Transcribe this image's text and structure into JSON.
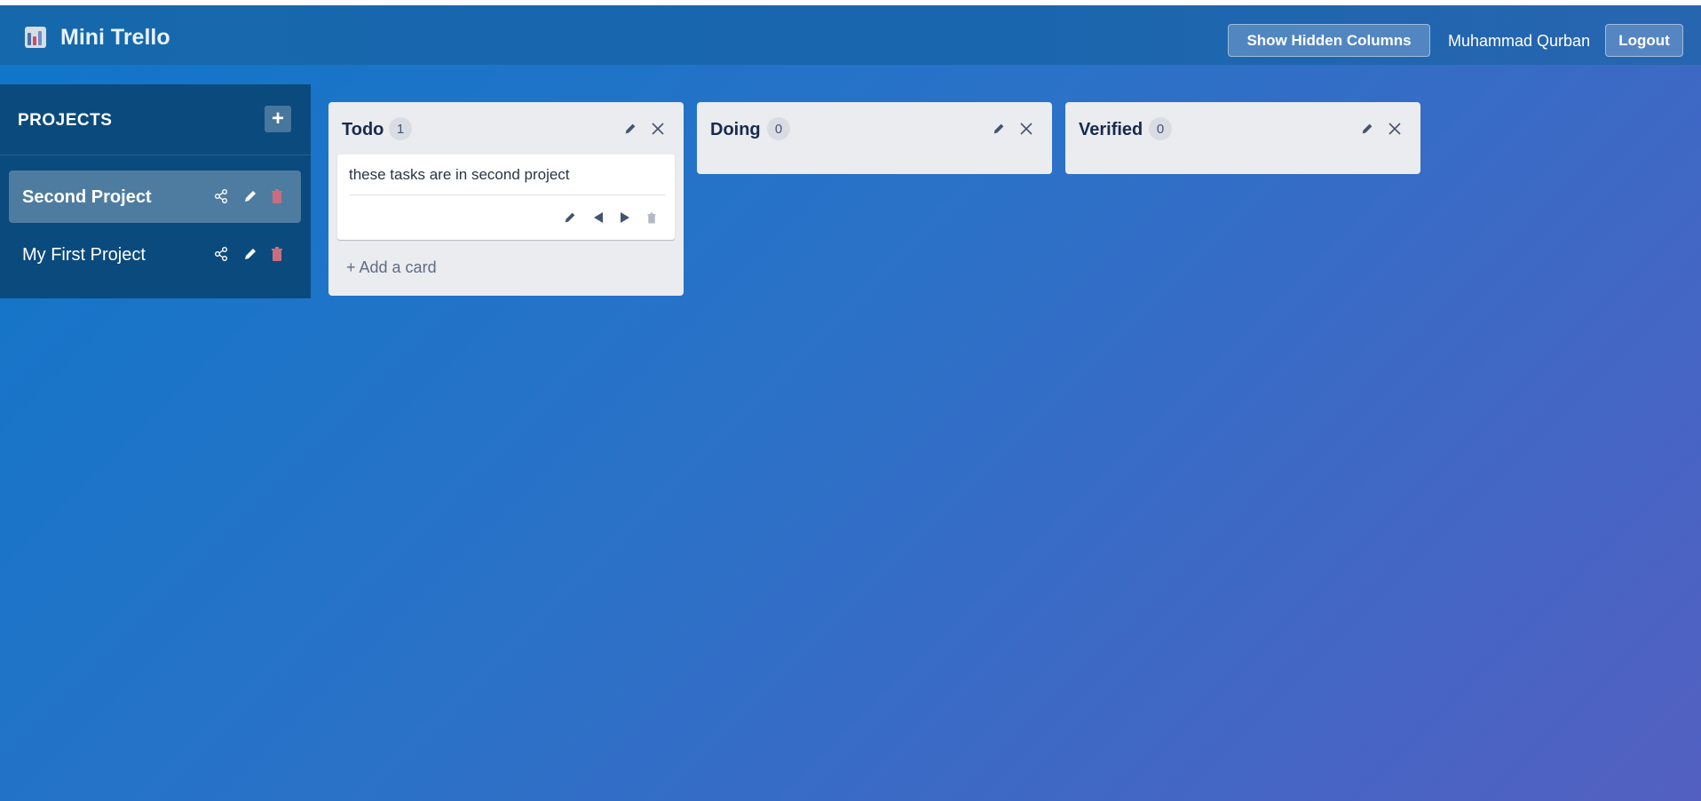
{
  "header": {
    "app_title": "Mini Trello",
    "logo_icon": "chart-icon",
    "show_hidden_label": "Show Hidden Columns",
    "user_name": "Muhammad Qurban",
    "logout_label": "Logout"
  },
  "sidebar": {
    "title": "PROJECTS",
    "add_label": "+",
    "projects": [
      {
        "name": "Second Project",
        "active": true,
        "icons": [
          "share-icon",
          "pencil-icon",
          "trash-icon"
        ]
      },
      {
        "name": "My First Project",
        "active": false,
        "icons": [
          "share-icon",
          "pencil-icon",
          "trash-icon"
        ]
      }
    ]
  },
  "board": {
    "columns": [
      {
        "title": "Todo",
        "count": "1",
        "cards": [
          {
            "text": "these tasks are in second project"
          }
        ],
        "add_card_label": "+ Add a card"
      },
      {
        "title": "Doing",
        "count": "0",
        "cards": []
      },
      {
        "title": "Verified",
        "count": "0",
        "cards": []
      }
    ]
  },
  "colors": {
    "header": "#1668ad",
    "sidebar": "#0b4a7d",
    "column": "#ebecf0",
    "trash": "#c86e7f"
  }
}
